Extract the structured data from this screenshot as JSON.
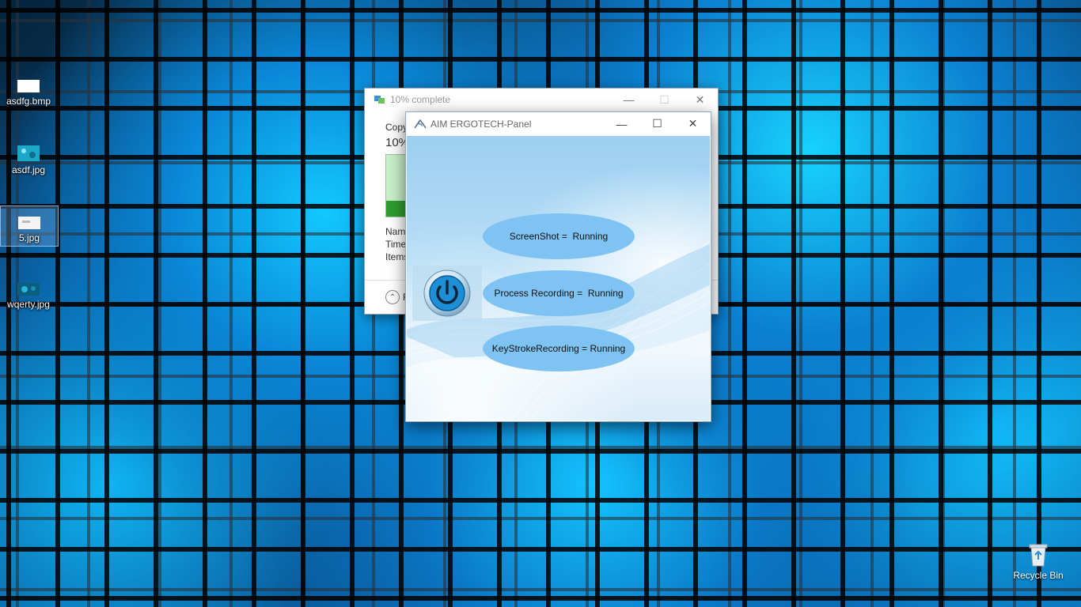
{
  "desktop": {
    "icons": [
      {
        "label": "asdfg.bmp"
      },
      {
        "label": "asdf.jpg"
      },
      {
        "label": "5.jpg"
      },
      {
        "label": "wqerty.jpg"
      }
    ],
    "recycle_bin": {
      "label": "Recycle Bin"
    }
  },
  "copy_dialog": {
    "title": "10% complete",
    "progress_percent": 10,
    "copy_label": "Copy",
    "percent_label": "10%",
    "info_lines": [
      "Nam",
      "Time",
      "Items"
    ],
    "fewer_details_label": "F"
  },
  "aim_panel": {
    "title": "AIM ERGOTECH-Panel",
    "status_items": [
      {
        "label": "ScreenShot =  Running"
      },
      {
        "label": "Process Recording =  Running"
      },
      {
        "label": "KeyStrokeRecording = Running"
      }
    ],
    "colors": {
      "pill": "#7ec3f2",
      "power_button": "#1e8fd6"
    }
  },
  "window_controls": {
    "minimize": "—",
    "maximize": "☐",
    "close": "✕"
  }
}
